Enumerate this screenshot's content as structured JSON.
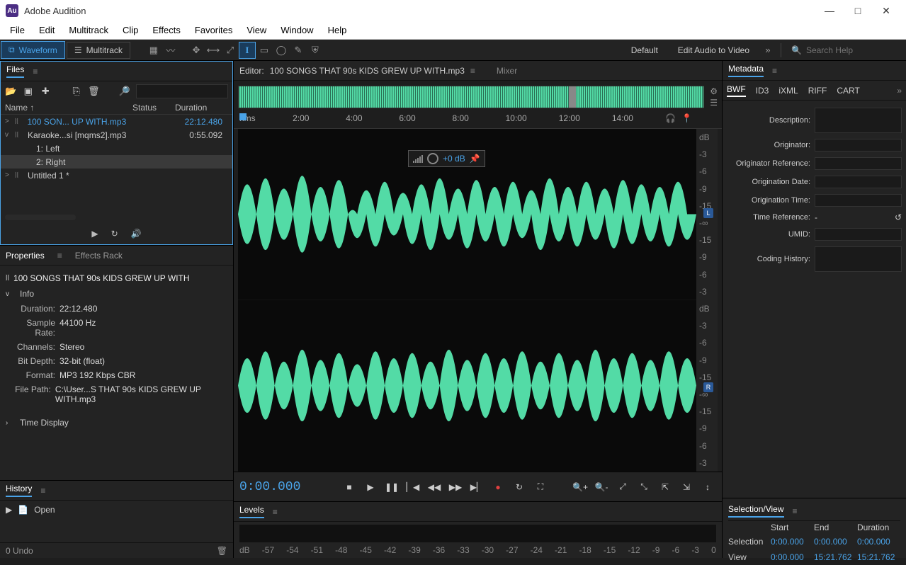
{
  "app": {
    "title": "Adobe Audition",
    "logo": "Au"
  },
  "menubar": [
    "File",
    "Edit",
    "Multitrack",
    "Clip",
    "Effects",
    "Favorites",
    "View",
    "Window",
    "Help"
  ],
  "toolbar": {
    "waveform": "Waveform",
    "multitrack": "Multitrack",
    "workspace_default": "Default",
    "workspace_editav": "Edit Audio to Video",
    "search_placeholder": "Search Help"
  },
  "files": {
    "title": "Files",
    "headers": {
      "name": "Name ↑",
      "status": "Status",
      "duration": "Duration"
    },
    "items": [
      {
        "exp": ">",
        "name": "100 SON... UP WITH.mp3",
        "status": "",
        "duration": "22:12.480",
        "selected": true
      },
      {
        "exp": "v",
        "name": "Karaoke...si [mqms2].mp3",
        "status": "",
        "duration": "0:55.092"
      },
      {
        "sub": true,
        "name": "1: Left"
      },
      {
        "sub": true,
        "name": "2: Right",
        "selected": true
      },
      {
        "exp": ">",
        "name": "Untitled 1 *",
        "status": "",
        "duration": ""
      }
    ]
  },
  "properties": {
    "tab_props": "Properties",
    "tab_fx": "Effects Rack",
    "filename": "100 SONGS THAT 90s KIDS GREW UP WITH",
    "section_info": "Info",
    "section_time": "Time Display",
    "rows": {
      "duration_k": "Duration:",
      "duration_v": "22:12.480",
      "samplerate_k": "Sample Rate:",
      "samplerate_v": "44100 Hz",
      "channels_k": "Channels:",
      "channels_v": "Stereo",
      "bitdepth_k": "Bit Depth:",
      "bitdepth_v": "32-bit (float)",
      "format_k": "Format:",
      "format_v": "MP3 192 Kbps CBR",
      "filepath_k": "File Path:",
      "filepath_v": "C:\\User...S THAT 90s KIDS GREW UP WITH.mp3"
    }
  },
  "history": {
    "title": "History",
    "open": "Open",
    "undo": "0 Undo"
  },
  "editor": {
    "prefix": "Editor:",
    "filename": "100 SONGS THAT 90s KIDS GREW UP WITH.mp3",
    "mixer": "Mixer",
    "ruler_label": "hms",
    "ticks": [
      "2:00",
      "4:00",
      "6:00",
      "8:00",
      "10:00",
      "12:00",
      "14:00"
    ],
    "hud_gain": "+0 dB",
    "db_marks": [
      "dB",
      "-3",
      "-6",
      "-9",
      "-15",
      "-∞",
      "-15",
      "-9",
      "-6",
      "-3"
    ],
    "ch_l": "L",
    "ch_r": "R"
  },
  "transport": {
    "timecode": "0:00.000"
  },
  "levels": {
    "title": "Levels",
    "scale": [
      "dB",
      "-57",
      "-54",
      "-51",
      "-48",
      "-45",
      "-42",
      "-39",
      "-36",
      "-33",
      "-30",
      "-27",
      "-24",
      "-21",
      "-18",
      "-15",
      "-12",
      "-9",
      "-6",
      "-3",
      "0"
    ]
  },
  "metadata": {
    "title": "Metadata",
    "tabs": [
      "BWF",
      "ID3",
      "iXML",
      "RIFF",
      "CART"
    ],
    "fields": {
      "description": "Description:",
      "originator": "Originator:",
      "originator_ref": "Originator Reference:",
      "orig_date": "Origination Date:",
      "orig_time": "Origination Time:",
      "time_ref": "Time Reference:",
      "time_ref_v": "-",
      "umid": "UMID:",
      "coding": "Coding History:"
    }
  },
  "selview": {
    "title": "Selection/View",
    "h_start": "Start",
    "h_end": "End",
    "h_duration": "Duration",
    "r_sel": "Selection",
    "sel_start": "0:00.000",
    "sel_end": "0:00.000",
    "sel_dur": "0:00.000",
    "r_view": "View",
    "view_start": "0:00.000",
    "view_end": "15:21.762",
    "view_dur": "15:21.762"
  }
}
